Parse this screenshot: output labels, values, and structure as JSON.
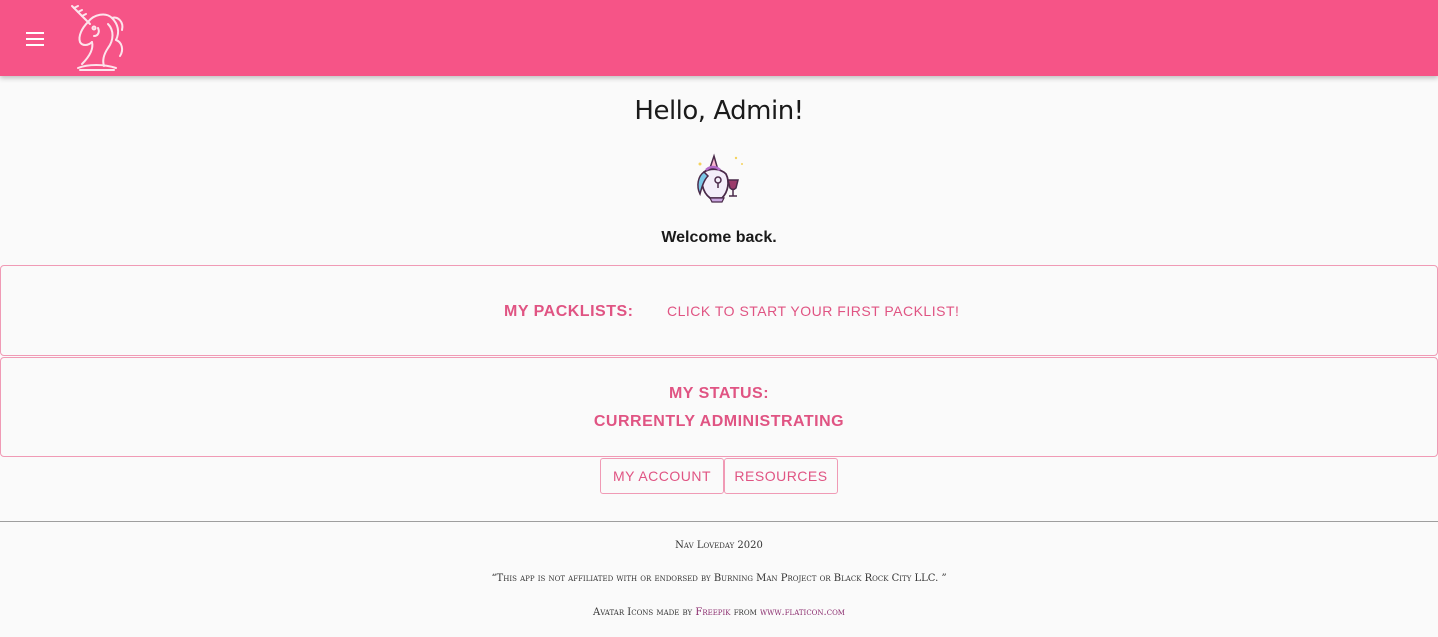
{
  "header": {
    "menu_icon": "hamburger-menu-icon",
    "logo_icon": "unicorn-logo-icon",
    "background": "#f65487"
  },
  "main": {
    "greeting": "Hello, Admin!",
    "avatar_icon": "unicorn-avatar-icon",
    "welcome": "Welcome back."
  },
  "packlists": {
    "label": "MY PACKLISTS:",
    "link": "CLICK TO START YOUR FIRST PACKLIST!"
  },
  "status": {
    "label": "MY STATUS:",
    "value": "CURRENTLY ADMINISTRATING"
  },
  "buttons": {
    "account": "MY ACCOUNT",
    "resources": "RESOURCES"
  },
  "footer": {
    "credit": "Nav Loveday 2020",
    "disclaimer": "“This app is not affiliated with or endorsed by Burning Man Project or Black Rock City LLC. ”",
    "icons_prefix": "Avatar Icons made by",
    "icons_author": "Freepik",
    "icons_from": "from",
    "icons_site": "www.flaticon.com"
  },
  "colors": {
    "accent": "#e05483",
    "border": "#f09ab5",
    "footer_link": "#8a2b6d"
  }
}
